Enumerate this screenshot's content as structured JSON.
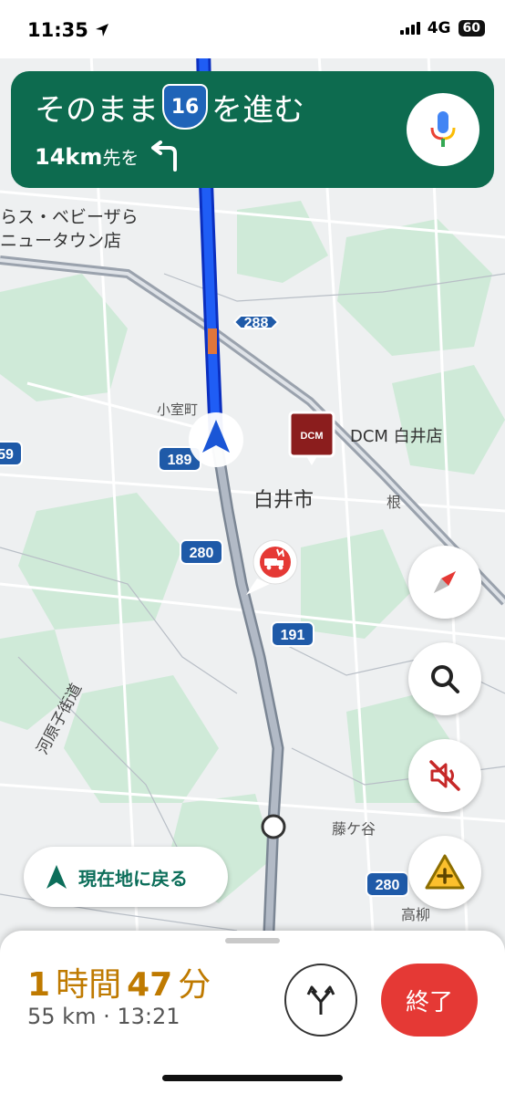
{
  "status_bar": {
    "time": "11:35",
    "network": "4G",
    "battery": "60"
  },
  "navigation": {
    "instruction_before": "そのまま",
    "route_number": "16",
    "instruction_after": "を進む",
    "distance": "14km",
    "distance_suffix": "先を"
  },
  "map": {
    "labels": {
      "store_line1": "らス・ベビーザら",
      "store_line2": "ニュータウン店",
      "komuro": "小室町",
      "city": "白井市",
      "dcm": "DCM 白井店",
      "dcm_logo": "DCM",
      "ne": "根",
      "fujigaya": "藤ケ谷",
      "takayanagi": "高柳",
      "kawarago": "河原子街道"
    },
    "route_shields": [
      "288",
      "189",
      "280",
      "191",
      "280",
      "59"
    ]
  },
  "controls": {
    "recenter_label": "現在地に戻る"
  },
  "trip": {
    "hours": "1",
    "hours_unit": "時間",
    "minutes": "47",
    "minutes_unit": "分",
    "summary": "55 km · 13:21",
    "end_label": "終了"
  }
}
